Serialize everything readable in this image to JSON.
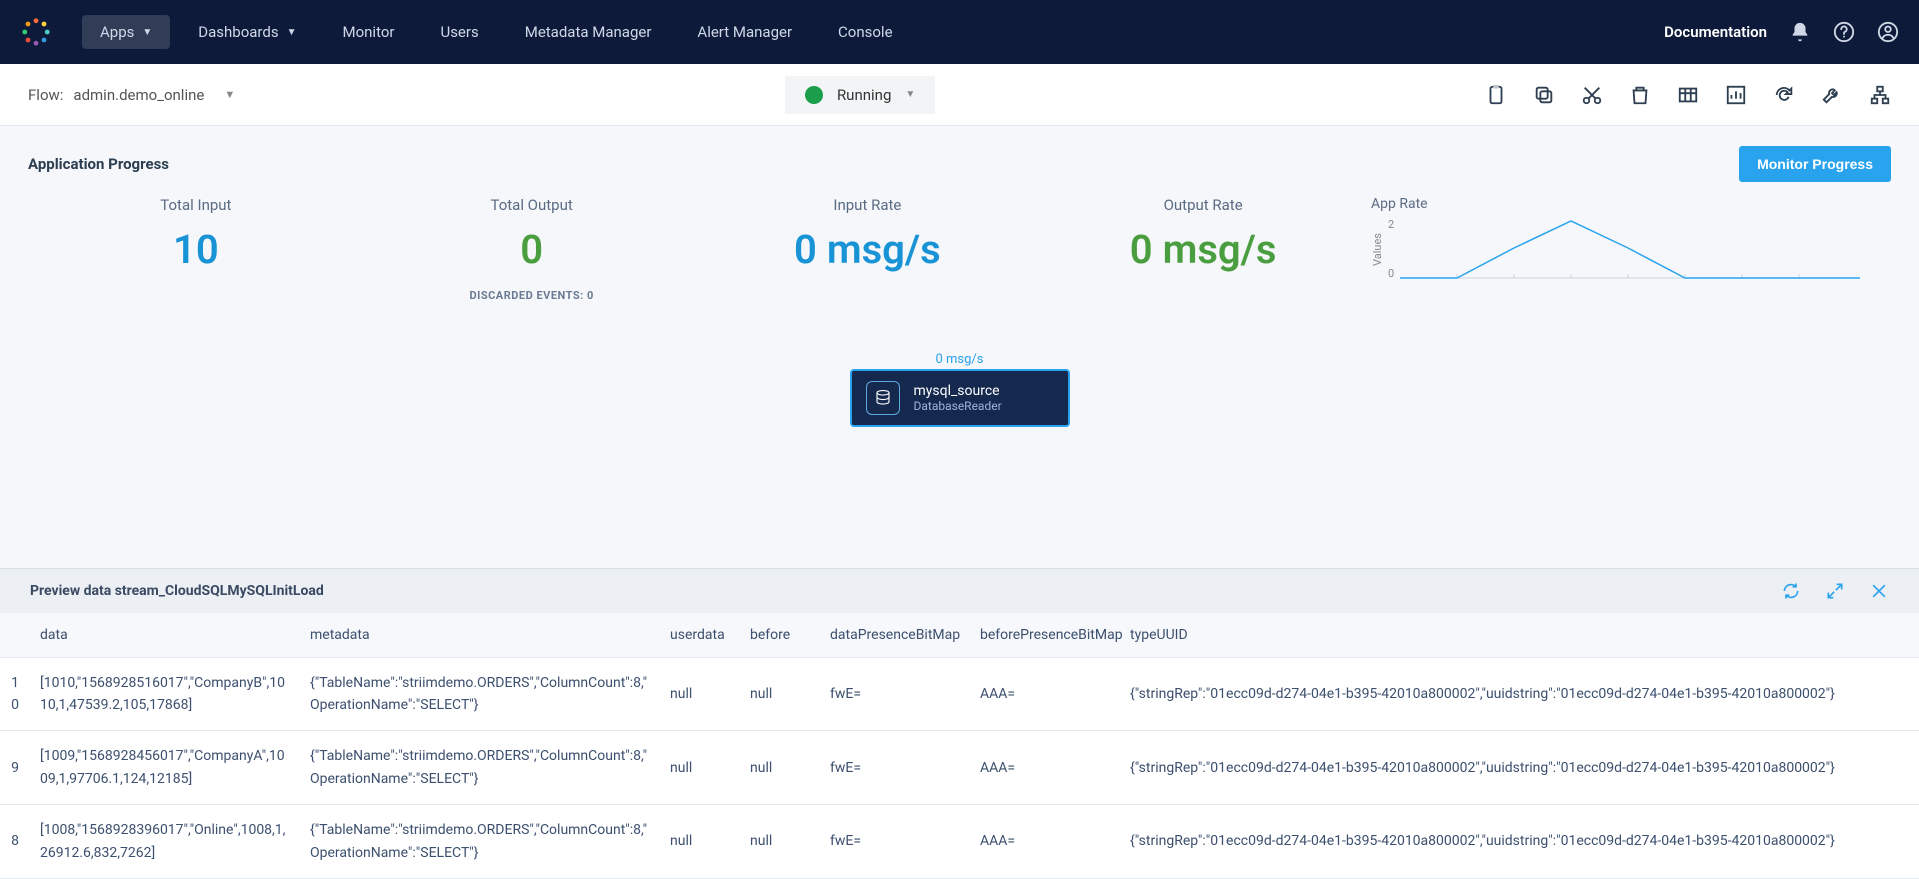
{
  "nav": {
    "items": [
      "Apps",
      "Dashboards",
      "Monitor",
      "Users",
      "Metadata Manager",
      "Alert Manager",
      "Console"
    ],
    "documentation": "Documentation"
  },
  "flow": {
    "prefix": "Flow:",
    "name": "admin.demo_online",
    "status": "Running"
  },
  "progress": {
    "title": "Application Progress",
    "monitor_btn": "Monitor Progress",
    "stats": {
      "total_input_label": "Total Input",
      "total_input_value": "10",
      "total_output_label": "Total Output",
      "total_output_value": "0",
      "discarded": "DISCARDED EVENTS: 0",
      "input_rate_label": "Input Rate",
      "input_rate_value": "0 msg/s",
      "output_rate_label": "Output Rate",
      "output_rate_value": "0 msg/s"
    },
    "chart": {
      "title": "App Rate",
      "y_label": "Values",
      "y_ticks": [
        "2",
        "0"
      ]
    }
  },
  "canvas": {
    "msg_rate": "0 msg/s",
    "node_title": "mysql_source",
    "node_sub": "DatabaseReader"
  },
  "preview": {
    "title": "Preview data stream_CloudSQLMySQLInitLoad",
    "headers": [
      "data",
      "metadata",
      "userdata",
      "before",
      "dataPresenceBitMap",
      "beforePresenceBitMap",
      "typeUUID"
    ],
    "rows": [
      {
        "idx": "10",
        "data": "[1010,\"1568928516017\",\"CompanyB\",1010,1,47539.2,105,17868]",
        "metadata": "{\"TableName\":\"striimdemo.ORDERS\",\"ColumnCount\":8,\"OperationName\":\"SELECT\"}",
        "userdata": "null",
        "before": "null",
        "dataPresenceBitMap": "fwE=",
        "beforePresenceBitMap": "AAA=",
        "typeUUID": "{\"stringRep\":\"01ecc09d-d274-04e1-b395-42010a800002\",\"uuidstring\":\"01ecc09d-d274-04e1-b395-42010a800002\"}"
      },
      {
        "idx": "9",
        "data": "[1009,\"1568928456017\",\"CompanyA\",1009,1,97706.1,124,12185]",
        "metadata": "{\"TableName\":\"striimdemo.ORDERS\",\"ColumnCount\":8,\"OperationName\":\"SELECT\"}",
        "userdata": "null",
        "before": "null",
        "dataPresenceBitMap": "fwE=",
        "beforePresenceBitMap": "AAA=",
        "typeUUID": "{\"stringRep\":\"01ecc09d-d274-04e1-b395-42010a800002\",\"uuidstring\":\"01ecc09d-d274-04e1-b395-42010a800002\"}"
      },
      {
        "idx": "8",
        "data": "[1008,\"1568928396017\",\"Online\",1008,1,26912.6,832,7262]",
        "metadata": "{\"TableName\":\"striimdemo.ORDERS\",\"ColumnCount\":8,\"OperationName\":\"SELECT\"}",
        "userdata": "null",
        "before": "null",
        "dataPresenceBitMap": "fwE=",
        "beforePresenceBitMap": "AAA=",
        "typeUUID": "{\"stringRep\":\"01ecc09d-d274-04e1-b395-42010a800002\",\"uuidstring\":\"01ecc09d-d274-04e1-b395-42010a800002\"}"
      }
    ]
  },
  "chart_data": {
    "type": "line",
    "title": "App Rate",
    "ylabel": "Values",
    "ylim": [
      0,
      2
    ],
    "x": [
      0,
      1,
      2,
      3,
      4,
      5,
      6,
      7,
      8
    ],
    "values": [
      0,
      0,
      1,
      2,
      1,
      0,
      0,
      0,
      0
    ]
  }
}
